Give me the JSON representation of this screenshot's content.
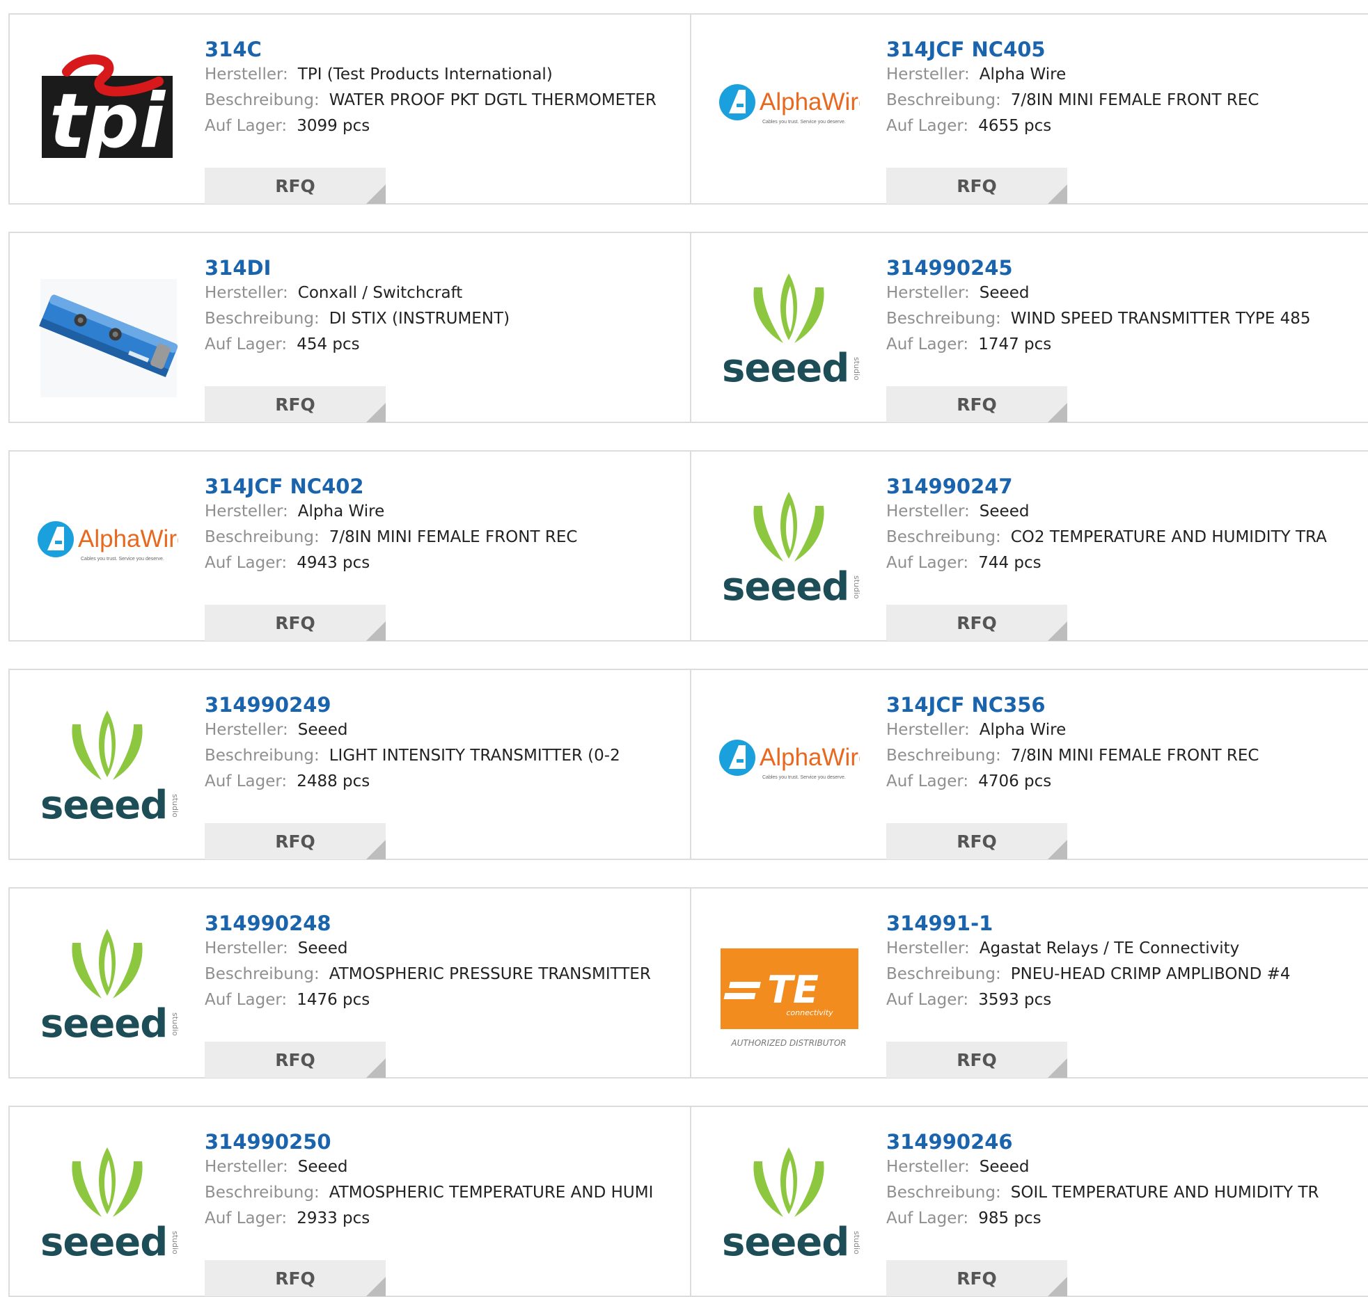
{
  "labels": {
    "manufacturer": "Hersteller:",
    "description": "Beschreibung:",
    "stock": "Auf Lager:"
  },
  "rfq_label": "RFQ",
  "brand_text": {
    "tpi": "tpi",
    "alpha": "AlphaWire",
    "alpha_tagline": "Cables you trust. Service you deserve.",
    "seeed": "seeed",
    "seeed_sub": "studio",
    "te": "TE",
    "te_sub": "connectivity",
    "te_caption": "AUTHORIZED DISTRIBUTOR"
  },
  "colors": {
    "part_link": "#1a63ad",
    "label_gray": "#8f8f8f",
    "button_bg": "#ececec",
    "alpha_blue": "#1aa0dc",
    "alpha_orange": "#e8681f",
    "seeed_green": "#8dc63f",
    "seeed_dark": "#1d4d56",
    "te_orange": "#f28c1e",
    "tpi_red": "#d7191c"
  },
  "products": [
    {
      "part": "314C",
      "manufacturer": "TPI (Test Products International)",
      "description": "WATER PROOF PKT DGTL THERMOMETER",
      "stock": "3099 pcs",
      "logo": "tpi-logo"
    },
    {
      "part": "314JCF NC405",
      "manufacturer": "Alpha Wire",
      "description": "7/8IN MINI FEMALE FRONT REC",
      "stock": "4655 pcs",
      "logo": "alphawire-logo"
    },
    {
      "part": "314DI",
      "manufacturer": "Conxall / Switchcraft",
      "description": "DI STIX (INSTRUMENT)",
      "stock": "454 pcs",
      "logo": "di-stix-product-image"
    },
    {
      "part": "314990245",
      "manufacturer": "Seeed",
      "description": "WIND SPEED TRANSMITTER TYPE 485",
      "stock": "1747 pcs",
      "logo": "seeed-studio-logo"
    },
    {
      "part": "314JCF NC402",
      "manufacturer": "Alpha Wire",
      "description": "7/8IN MINI FEMALE FRONT REC",
      "stock": "4943 pcs",
      "logo": "alphawire-logo"
    },
    {
      "part": "314990247",
      "manufacturer": "Seeed",
      "description": "CO2 TEMPERATURE AND HUMIDITY TRA",
      "stock": "744 pcs",
      "logo": "seeed-studio-logo"
    },
    {
      "part": "314990249",
      "manufacturer": "Seeed",
      "description": "LIGHT INTENSITY TRANSMITTER (0-2",
      "stock": "2488 pcs",
      "logo": "seeed-studio-logo"
    },
    {
      "part": "314JCF NC356",
      "manufacturer": "Alpha Wire",
      "description": "7/8IN MINI FEMALE FRONT REC",
      "stock": "4706 pcs",
      "logo": "alphawire-logo"
    },
    {
      "part": "314990248",
      "manufacturer": "Seeed",
      "description": "ATMOSPHERIC PRESSURE TRANSMITTER",
      "stock": "1476 pcs",
      "logo": "seeed-studio-logo"
    },
    {
      "part": "314991-1",
      "manufacturer": "Agastat Relays / TE Connectivity",
      "description": "PNEU-HEAD CRIMP AMPLIBOND #4",
      "stock": "3593 pcs",
      "logo": "te-connectivity-logo"
    },
    {
      "part": "314990250",
      "manufacturer": "Seeed",
      "description": "ATMOSPHERIC TEMPERATURE AND HUMI",
      "stock": "2933 pcs",
      "logo": "seeed-studio-logo"
    },
    {
      "part": "314990246",
      "manufacturer": "Seeed",
      "description": "SOIL TEMPERATURE AND HUMIDITY TR",
      "stock": "985 pcs",
      "logo": "seeed-studio-logo"
    }
  ]
}
